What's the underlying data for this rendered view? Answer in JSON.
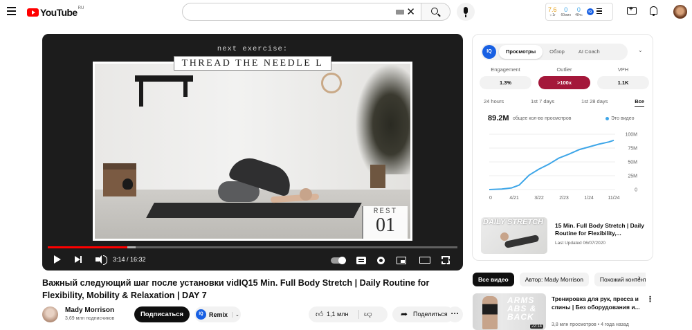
{
  "header": {
    "logo_text": "YouTube",
    "region": "RU",
    "search_value": "",
    "stats": [
      {
        "value": "7.6",
        "label": "☼1г",
        "color": "#e6a019"
      },
      {
        "value": "0",
        "label": "60мин",
        "color": "#3ea6e8"
      },
      {
        "value": "0",
        "label": "48чс",
        "color": "#3ea6e8"
      }
    ],
    "iq_badge": "IQ"
  },
  "player": {
    "next_label": "next exercise:",
    "exercise_title": "THREAD THE NEEDLE L",
    "rest_label": "REST",
    "rest_number": "01",
    "time": "3:14 / 16:32",
    "progress_played": 0.195,
    "progress_buffered": 0.215
  },
  "video": {
    "title": "Важный следующий шаг после установки vidIQ15 Min. Full Body Stretch | Daily Routine for Flexibility, Mobility & Relaxation | DAY 7",
    "channel_name": "Mady Morrison",
    "subscribers": "3,69 млн подписчиков",
    "subscribe_label": "Подписаться",
    "remix_label": "Remix",
    "remix_badge": "IQ",
    "likes": "1,1 млн",
    "share_label": "Поделиться",
    "more": "···"
  },
  "panel": {
    "logo": "IQ",
    "tabs": [
      "Просмотры",
      "Обзор",
      "AI Coach"
    ],
    "active_tab": "Просмотры",
    "metrics": [
      {
        "label": "Engagement",
        "value": "1.3%"
      },
      {
        "label": "Outlier",
        "value": ">100x"
      },
      {
        "label": "VPH",
        "value": "1.1K"
      }
    ],
    "ranges": [
      "24 hours",
      "1st 7 days",
      "1st 28 days",
      "Все"
    ],
    "active_range": "Все",
    "total_views": "89.2M",
    "total_views_desc": "общее кол-во просмотров",
    "legend_label": "Это видео",
    "feature": {
      "thumb_text": "DAILY STRETCH",
      "title": "15 Min. Full Body Stretch | Daily Routine for Flexibility,...",
      "date": "Last Updated 06/07/2020"
    }
  },
  "chart_data": {
    "type": "line",
    "title": "",
    "xlabel": "",
    "ylabel": "",
    "x_ticks": [
      "0",
      "4/21",
      "3/22",
      "2/23",
      "1/24",
      "11/24"
    ],
    "y_ticks": [
      "100M",
      "75M",
      "50M",
      "25M",
      "0"
    ],
    "ylim": [
      0,
      100
    ],
    "series": [
      {
        "name": "Это видео",
        "color": "#3ea6e8",
        "x": [
          0,
          0.5,
          0.9,
          1.2,
          1.6,
          2.0,
          2.4,
          2.8,
          3.2,
          3.6,
          4.0,
          4.4,
          4.8,
          5.0
        ],
        "values": [
          0,
          1,
          3,
          8,
          26,
          37,
          46,
          57,
          64,
          72,
          77,
          82,
          86,
          89
        ]
      }
    ]
  },
  "recommendations": {
    "chips": [
      "Все видео",
      "Автор: Mady Morrison",
      "Похожий контент"
    ],
    "active_chip": "Все видео",
    "items": [
      {
        "thumb_text": "ARMS ABS & BACK",
        "duration": "22:14",
        "title": "Тренировка для рук, пресса и спины | Без оборудования и...",
        "meta": "3,8 млн просмотров • 4 года назад"
      }
    ]
  }
}
